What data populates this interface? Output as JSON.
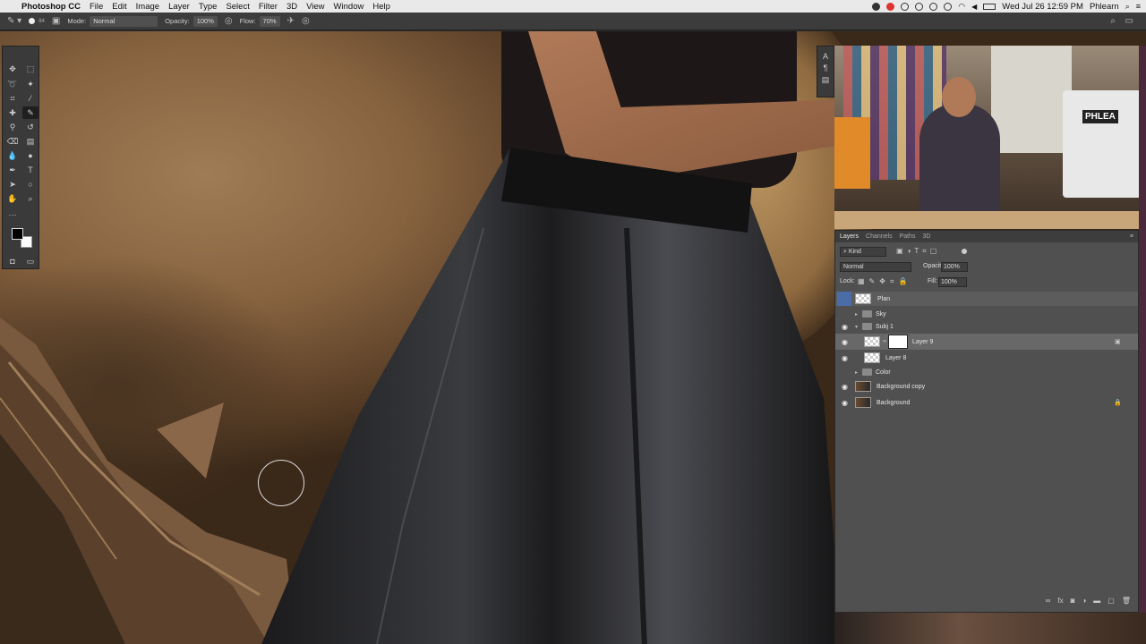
{
  "menubar": {
    "app": "Photoshop CC",
    "items": [
      "File",
      "Edit",
      "Image",
      "Layer",
      "Type",
      "Select",
      "Filter",
      "3D",
      "View",
      "Window",
      "Help"
    ],
    "datetime": "Wed Jul 26  12:59 PM",
    "user": "Phlearn"
  },
  "options": {
    "brush_size": "84",
    "mode_label": "Mode:",
    "mode_value": "Normal",
    "opacity_label": "Opacity:",
    "opacity_value": "100%",
    "flow_label": "Flow:",
    "flow_value": "70%"
  },
  "video": {
    "sign_text": "PHLEA"
  },
  "layers_panel": {
    "tabs": [
      "Layers",
      "Channels",
      "Paths",
      "3D"
    ],
    "filter_label": "Kind",
    "blend_mode": "Normal",
    "opacity_label": "Opacity:",
    "opacity_value": "100%",
    "lock_label": "Lock:",
    "fill_label": "Fill:",
    "fill_value": "100%",
    "layers": [
      {
        "name": "Plan"
      },
      {
        "name": "Sky"
      },
      {
        "name": "Subj 1"
      },
      {
        "name": "Layer 9"
      },
      {
        "name": "Layer 8"
      },
      {
        "name": "Color"
      },
      {
        "name": "Background copy"
      },
      {
        "name": "Background"
      }
    ]
  },
  "colors": {
    "accent": "#4a6da8",
    "panel_bg": "#505050",
    "menubar_bg": "#e9e9ea"
  }
}
